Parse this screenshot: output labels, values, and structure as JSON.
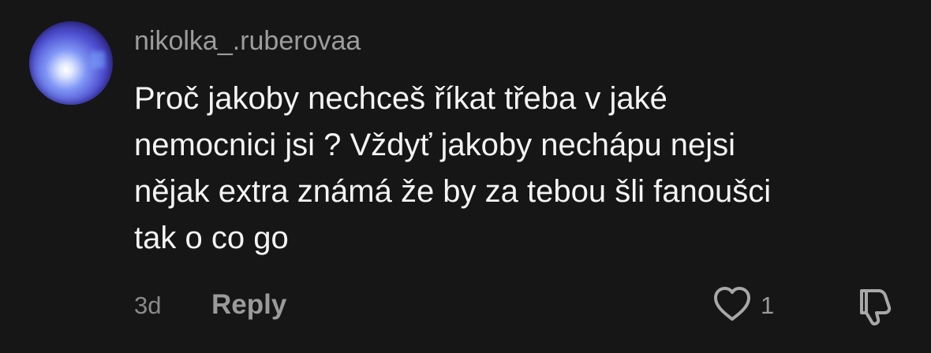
{
  "comment": {
    "username": "nikolka_.ruberovaa",
    "text": "Proč jakoby nechceš říkat třeba v jaké\nnemocnici jsi ? Vždyť jakoby nechápu nejsi\nnějak extra známá že by za tebou šli fanoušci\ntak o co go",
    "time": "3d",
    "reply_label": "Reply",
    "like_count": "1"
  },
  "colors": {
    "background": "#161616",
    "text": "#f4f4f4",
    "muted": "#9a9a9a"
  },
  "icons": {
    "like": "heart-outline-icon",
    "dislike": "thumbs-down-icon"
  }
}
